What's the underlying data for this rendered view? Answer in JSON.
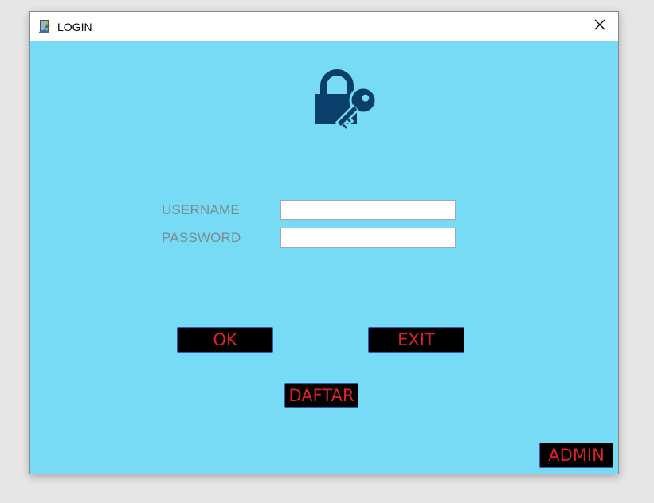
{
  "window": {
    "title": "LOGIN",
    "app_icon": "door-exit-icon",
    "close_icon": "close-icon"
  },
  "header_icon": "lock-key-icon",
  "form": {
    "username_label": "USERNAME",
    "username_value": "",
    "password_label": "PASSWORD",
    "password_value": ""
  },
  "buttons": {
    "ok_label": "OK",
    "exit_label": "EXIT",
    "daftar_label": "DAFTAR",
    "admin_label": "ADMIN"
  },
  "colors": {
    "background": "#77dbf5",
    "button_bg": "#000000",
    "button_text": "#e0202a",
    "label_text": "#7a8a90",
    "icon": "#0b3f6b"
  }
}
